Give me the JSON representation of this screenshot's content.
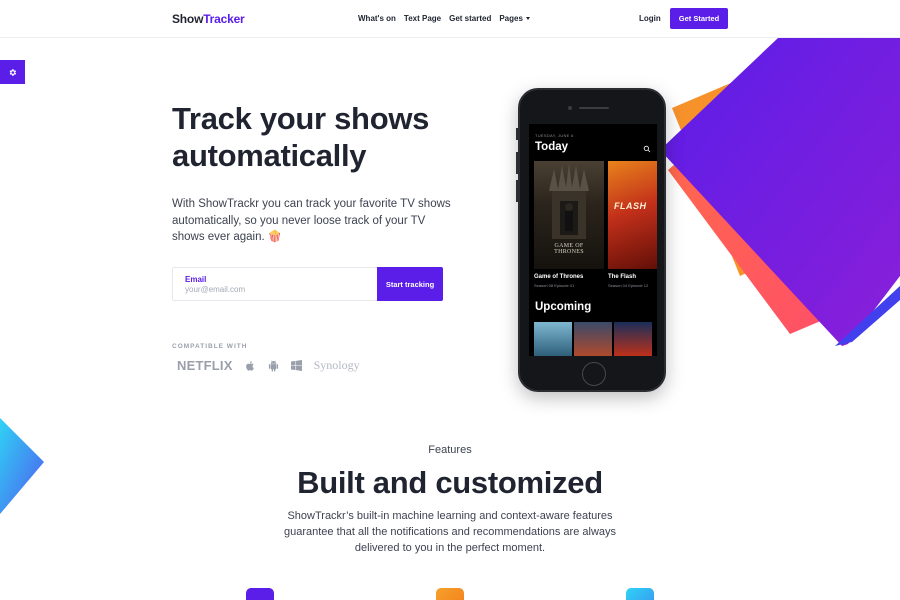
{
  "nav": {
    "brand_part1": "Show",
    "brand_part2": "Tracker",
    "links": [
      "What's on",
      "Text Page",
      "Get started",
      "Pages"
    ],
    "login": "Login",
    "cta": "Get Started"
  },
  "hero": {
    "title_line1": "Track your shows",
    "title_line2": "automatically",
    "text": "With ShowTrackr you can track your favorite TV shows automatically, so you never loose track of your TV shows ever again. 🍿",
    "email_label": "Email",
    "email_placeholder": "your@email.com",
    "email_value": "",
    "submit": "Start tracking",
    "compatible_label": "COMPATIBLE WITH",
    "logos": [
      "NETFLIX",
      "apple-icon",
      "android-icon",
      "windows-icon",
      "Synology"
    ]
  },
  "phone": {
    "date": "TUESDAY, JUNE 6",
    "today": "Today",
    "shows": [
      {
        "title": "Game of Thrones",
        "subtitle": "Season 08 Episode 01",
        "poster_text": "GAME OF THRONES"
      },
      {
        "title": "The Flash",
        "subtitle": "Season 04 Episode 12",
        "poster_text": "FLASH"
      }
    ],
    "upcoming": "Upcoming"
  },
  "features": {
    "eyebrow": "Features",
    "title": "Built and customized",
    "text": "ShowTrackr’s built-in machine learning and context-aware features guarantee that all the notifications and recommendations are always delivered to you in the perfect moment."
  },
  "colors": {
    "accent": "#5b1de8",
    "orange": "#f7922b",
    "coral": "#ff5a5f",
    "text": "#1f2430"
  }
}
